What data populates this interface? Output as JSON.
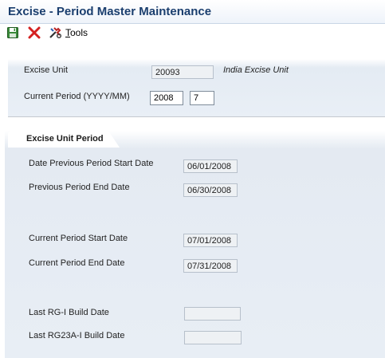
{
  "window": {
    "title": "Excise - Period Master Maintenance"
  },
  "toolbar": {
    "tools_label": "Tools",
    "tools_mnemonic": "T",
    "tools_rest": "ools"
  },
  "header": {
    "excise_unit_label": "Excise Unit",
    "excise_unit_value": "20093",
    "excise_unit_desc": "India Excise Unit",
    "current_period_label": "Current Period (YYYY/MM)",
    "current_period_year": "2008",
    "current_period_month": "7"
  },
  "tab": {
    "label": "Excise Unit Period",
    "prev_start_label": "Date Previous Period Start Date",
    "prev_start_value": "06/01/2008",
    "prev_end_label": "Previous Period End Date",
    "prev_end_value": "06/30/2008",
    "curr_start_label": "Current Period Start Date",
    "curr_start_value": "07/01/2008",
    "curr_end_label": "Current Period End Date",
    "curr_end_value": "07/31/2008",
    "rg1_label": "Last RG-I Build Date",
    "rg1_value": "",
    "rg23a_label": "Last RG23A-I Build Date",
    "rg23a_value": ""
  }
}
